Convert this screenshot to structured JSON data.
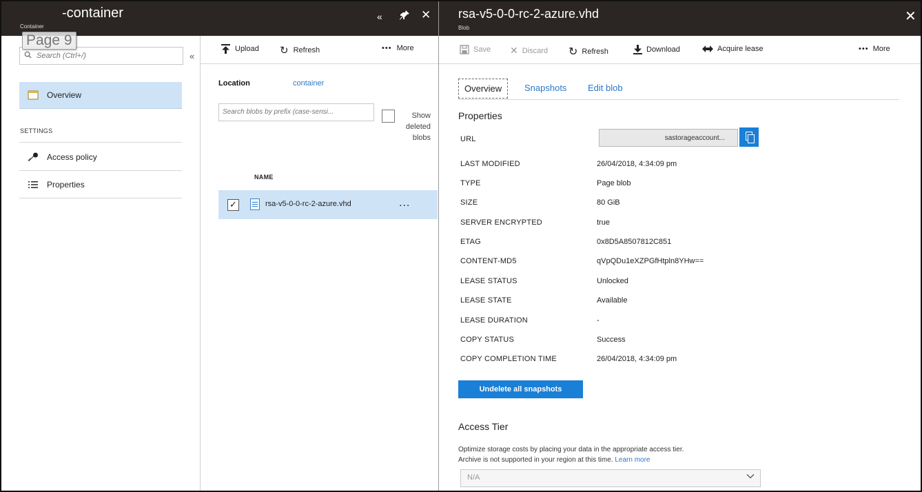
{
  "left_blade": {
    "title": "-container",
    "subtitle": "Container",
    "page_label": "Page 9",
    "search_placeholder": "Search (Ctrl+/)",
    "collapse": "«",
    "header_icons": {
      "collapse": "«",
      "pin": "✦",
      "close": "✕"
    },
    "menu": {
      "overview": "Overview",
      "settings_label": "SETTINGS",
      "access_policy": "Access policy",
      "properties": "Properties"
    },
    "toolbar": {
      "upload": "Upload",
      "refresh": "Refresh",
      "more": "More"
    },
    "location_label": "Location",
    "location_value": "container",
    "blob_search_placeholder": "Search blobs by prefix (case-sensi...",
    "show_deleted": "Show deleted blobs",
    "column_name": "NAME",
    "blob": {
      "name": "rsa-v5-0-0-rc-2-azure.vhd",
      "checked": "✓",
      "more": "..."
    }
  },
  "right_blade": {
    "title": "rsa-v5-0-0-rc-2-azure.vhd",
    "subtitle": "Blob",
    "close": "✕",
    "toolbar": {
      "save": "Save",
      "discard": "Discard",
      "refresh": "Refresh",
      "download": "Download",
      "acquire_lease": "Acquire lease",
      "more": "More"
    },
    "tabs": {
      "overview": "Overview",
      "snapshots": "Snapshots",
      "edit_blob": "Edit blob"
    },
    "properties_title": "Properties",
    "url_label": "URL",
    "url_value": "sastorageaccount...",
    "properties": [
      {
        "key": "LAST MODIFIED",
        "value": "26/04/2018, 4:34:09 pm"
      },
      {
        "key": "TYPE",
        "value": "Page blob"
      },
      {
        "key": "SIZE",
        "value": "80 GiB"
      },
      {
        "key": "SERVER ENCRYPTED",
        "value": "true"
      },
      {
        "key": "ETAG",
        "value": "0x8D5A8507812C851"
      },
      {
        "key": "CONTENT-MD5",
        "value": "qVpQDu1eXZPGfHtpln8YHw=="
      },
      {
        "key": "LEASE STATUS",
        "value": "Unlocked"
      },
      {
        "key": "LEASE STATE",
        "value": "Available"
      },
      {
        "key": "LEASE DURATION",
        "value": "-"
      },
      {
        "key": "COPY STATUS",
        "value": "Success"
      },
      {
        "key": "COPY COMPLETION TIME",
        "value": "26/04/2018, 4:34:09 pm"
      }
    ],
    "undelete_button": "Undelete all snapshots",
    "access_tier_title": "Access Tier",
    "access_tier_desc_1": "Optimize storage costs by placing your data in the appropriate access tier.",
    "access_tier_desc_2": "Archive is not supported in your region at this time.",
    "learn_more": "Learn more",
    "access_tier_value": "N/A"
  },
  "colors": {
    "header_bg": "#2b2523",
    "accent": "#1a7fd6",
    "selection": "#cfe3f7",
    "link": "#2b79c9"
  }
}
